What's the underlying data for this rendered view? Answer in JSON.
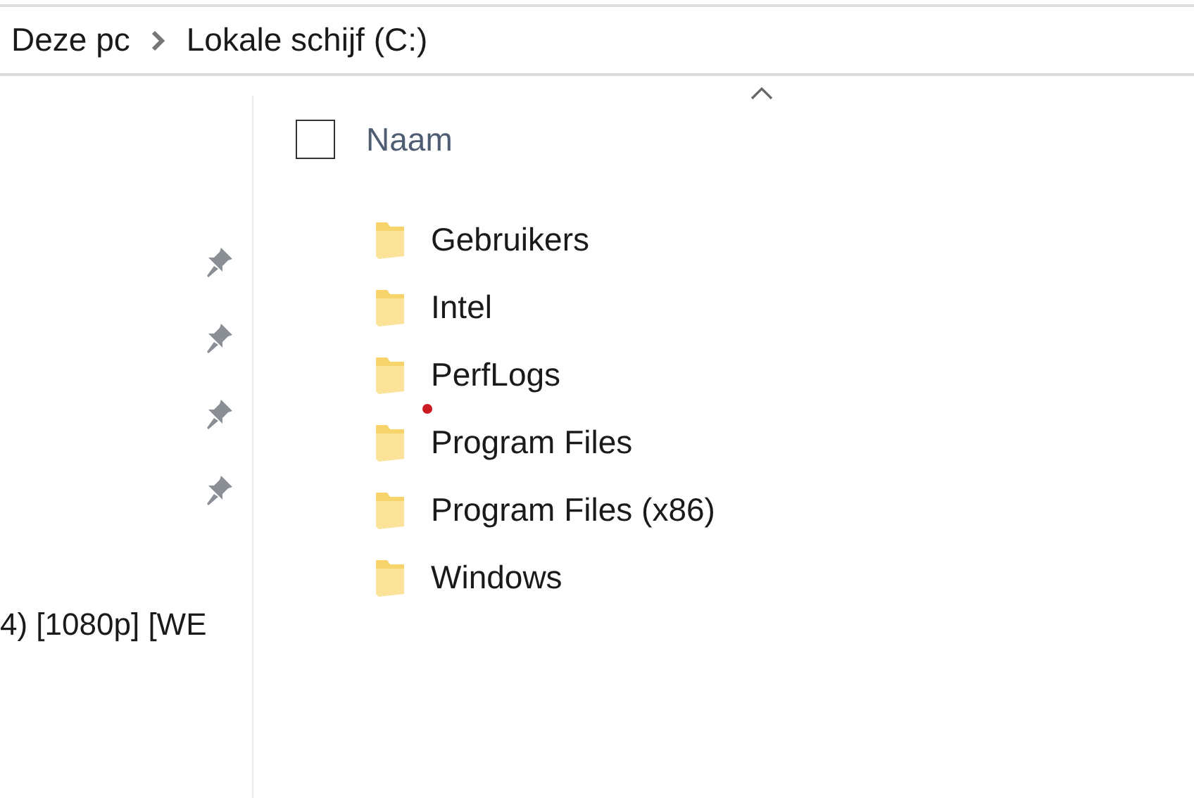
{
  "breadcrumb": [
    "Deze pc",
    "Lokale schijf (C:)"
  ],
  "navigation": [
    {
      "pinned": true
    },
    {
      "pinned": true
    },
    {
      "pinned": true
    },
    {
      "pinned": true
    },
    {
      "label": "4) [1080p] [WE",
      "pinned": false
    }
  ],
  "header": {
    "checked": false,
    "column": "Naam",
    "sorted_ascending": true
  },
  "folders": [
    "Gebruikers",
    "Intel",
    "PerfLogs",
    "Program Files",
    "Program Files (x86)",
    "Windows"
  ]
}
